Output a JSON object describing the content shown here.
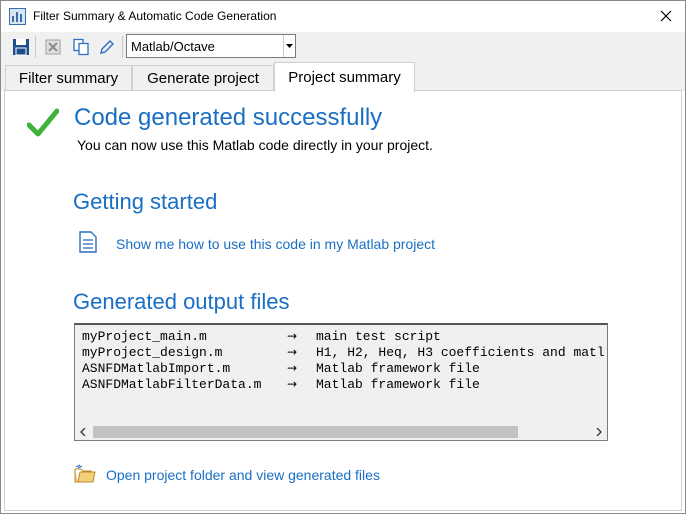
{
  "window": {
    "title": "Filter Summary & Automatic Code Generation"
  },
  "toolbar": {
    "icons": [
      "save-icon",
      "excel-export-icon",
      "copy-icon",
      "edit-icon"
    ],
    "language_selected": "Matlab/Octave"
  },
  "tabs": [
    {
      "label": "Filter summary",
      "active": false
    },
    {
      "label": "Generate project",
      "active": false
    },
    {
      "label": "Project summary",
      "active": true
    }
  ],
  "summary": {
    "success_heading": "Code generated successfully",
    "success_text": "You can now use this Matlab code directly in your project.",
    "getting_started_heading": "Getting started",
    "howto_link": "Show me how to use this code in my Matlab project",
    "output_heading": "Generated output files",
    "files": [
      {
        "name": "myProject_main.m",
        "arrow": "→",
        "desc": "main test script"
      },
      {
        "name": "myProject_design.m",
        "arrow": "→",
        "desc": "H1, H2, Heq, H3 coefficients and matl"
      },
      {
        "name": "ASNFDMatlabImport.m",
        "arrow": "→",
        "desc": "Matlab framework file"
      },
      {
        "name": "ASNFDMatlabFilterData.m",
        "arrow": "→",
        "desc": "Matlab framework file"
      }
    ],
    "folder_link": "Open project folder and view generated files"
  },
  "colors": {
    "accent": "#1a6fc4",
    "success": "#3cb43c"
  }
}
